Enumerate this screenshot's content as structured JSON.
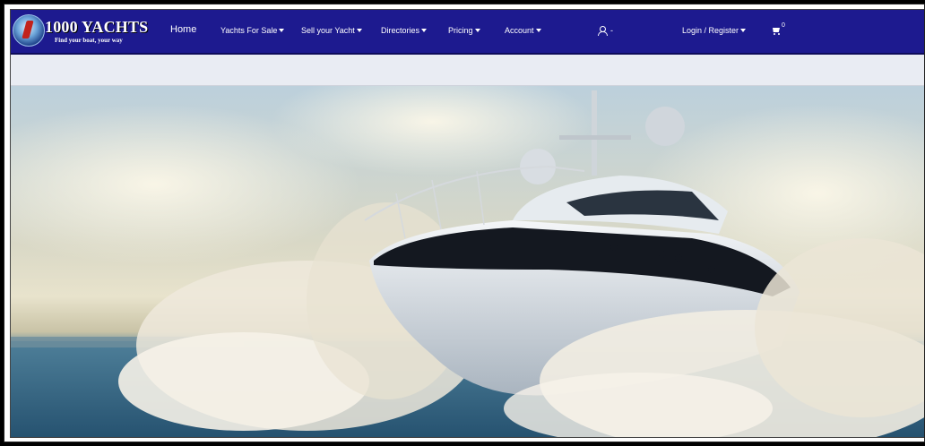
{
  "brand": {
    "title": "1000 YACHTS",
    "tagline": "Find your boat, your way"
  },
  "nav": {
    "home": "Home",
    "yachts_for_sale": "Yachts For Sale",
    "sell_your_yacht": "Sell your Yacht",
    "directories": "Directories",
    "pricing": "Pricing",
    "account": "Account",
    "user_label": "-",
    "login_register": "Login / Register",
    "cart_count": "0"
  },
  "icons": {
    "user": "user-icon",
    "cart": "cart-icon",
    "dropdown": "caret-down-icon"
  },
  "colors": {
    "navbar": "#1d1a8f",
    "subbar": "#e9ecf3",
    "nav_text": "#ffffff"
  },
  "hero": {
    "image_subject": "motor yacht speeding through spray"
  }
}
